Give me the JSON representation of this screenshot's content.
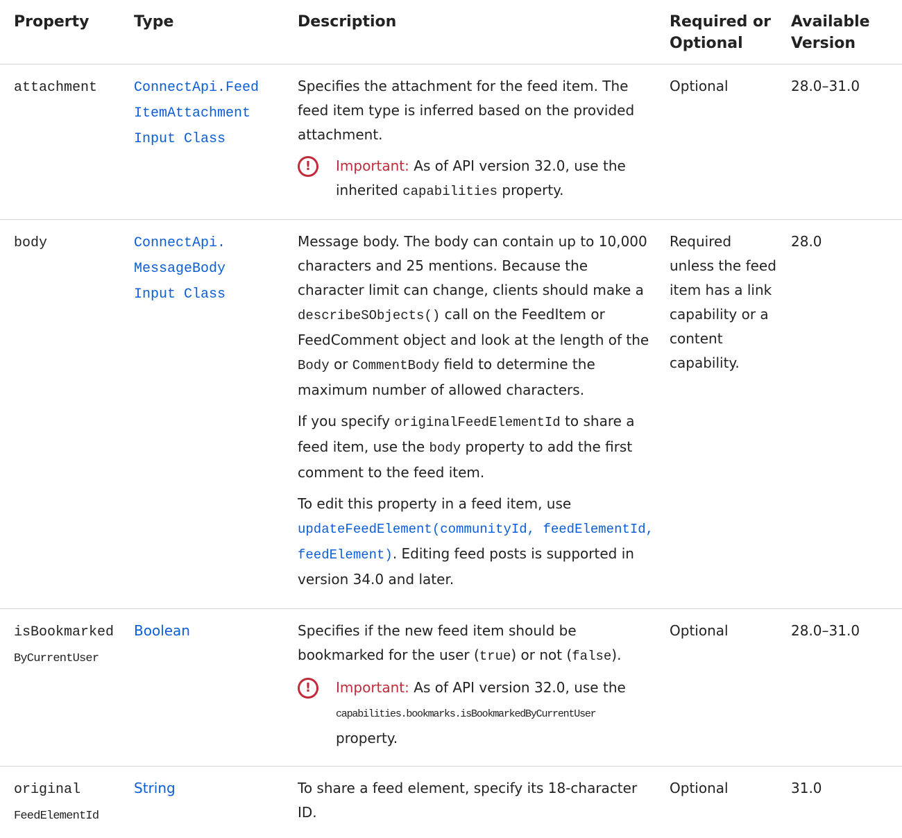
{
  "headers": {
    "property": "Property",
    "type": "Type",
    "description": "Description",
    "required_line1": "Required or",
    "required_line2": "Optional",
    "version_line1": "Available",
    "version_line2": "Version"
  },
  "rows": {
    "attachment": {
      "property": "attachment",
      "type_line1": "ConnectApi.Feed",
      "type_line2": "ItemAttachment",
      "type_line3": "Input Class",
      "desc": "Specifies the attachment for the feed item. The feed item type is inferred based on the provided attachment.",
      "important_label": "Important",
      "important_text_a": "As of API version 32.0, use the inherited",
      "important_code": "capabilities",
      "important_text_b": "property.",
      "required": "Optional",
      "version": "28.0–31.0"
    },
    "body": {
      "property": "body",
      "type_line1": "ConnectApi.",
      "type_line2": "MessageBody",
      "type_line3": "Input Class",
      "p1_a": "Message body. The body can contain up to 10,000 characters and 25 mentions. Because the character limit can change, clients should make a",
      "p1_code1": "describeSObjects()",
      "p1_b": "call on the FeedItem or FeedComment object and look at the length of the",
      "p1_code2": "Body",
      "p1_c": "or",
      "p1_code3": "CommentBody",
      "p1_d": "field to determine the maximum number of allowed characters.",
      "p2_a": "If you specify",
      "p2_code1": "originalFeedElementId",
      "p2_b": "to share a feed item, use the",
      "p2_code2": "body",
      "p2_c": "property to add the first comment to the feed item.",
      "p3_a": "To edit this property in a feed item, use",
      "p3_link": "updateFeedElement(communityId, feedElementId, feedElement)",
      "p3_b": ". Editing feed posts is supported in version 34.0 and later.",
      "required": "Required unless the feed item has a link capability or a content capability.",
      "version": "28.0"
    },
    "bookmarked": {
      "property_line1": "isBookmarked",
      "property_line2": "ByCurrentUser",
      "type": "Boolean",
      "desc_a": "Specifies if the new feed item should be bookmarked for the user (",
      "desc_code1": "true",
      "desc_b": ") or not (",
      "desc_code2": "false",
      "desc_c": ").",
      "important_label": "Important",
      "important_text_a": "As of API version 32.0, use the",
      "important_code": "capabilities.bookmarks.isBookmarkedByCurrentUser",
      "important_text_b": "property.",
      "required": "Optional",
      "version": "28.0–31.0"
    },
    "original": {
      "property_line1": "original",
      "property_line2": "FeedElementId",
      "type": "String",
      "desc": "To share a feed element, specify its 18-character ID.",
      "required": "Optional",
      "version": "31.0"
    }
  },
  "icons": {
    "important": "exclamation-circle-icon"
  },
  "colors": {
    "link": "#0b5ed7",
    "important": "#c22a3a",
    "rule": "#d4d4d4"
  }
}
